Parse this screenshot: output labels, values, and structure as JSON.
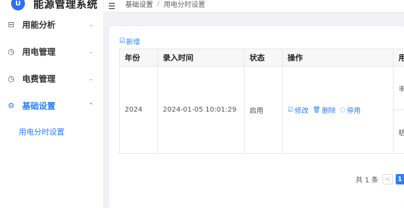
{
  "app": {
    "title": "能源管理系统",
    "logo_glyph": "U"
  },
  "sidebar": {
    "items": [
      {
        "label": "用能分析",
        "icon": "monitor-icon",
        "glyph": "⊟",
        "arrow": "⌄"
      },
      {
        "label": "用电管理",
        "icon": "gauge-icon",
        "glyph": "◷",
        "arrow": "⌄"
      },
      {
        "label": "电费管理",
        "icon": "gauge-icon",
        "glyph": "◷",
        "arrow": "⌄"
      },
      {
        "label": "基础设置",
        "icon": "gear-icon",
        "glyph": "⚙",
        "arrow": "⌃",
        "active": true
      }
    ],
    "sub_items": [
      {
        "label": "用电分时设置",
        "active": true
      }
    ]
  },
  "header": {
    "fold_glyph": "☰",
    "breadcrumb": [
      "基础设置",
      "用电分时设置"
    ],
    "separator": "/"
  },
  "toolbar": {
    "add_label": "新增",
    "add_glyph": "☑"
  },
  "table": {
    "columns": [
      "年份",
      "录入时间",
      "状态",
      "操作",
      "用电"
    ],
    "rows": [
      {
        "year": "2024",
        "created": "2024-01-05 10:01:29",
        "status": "启用",
        "actions": [
          {
            "label": "修改",
            "glyph": "☑"
          },
          {
            "label": "删除",
            "glyph": "🗑"
          },
          {
            "label": "停用",
            "glyph": "◌"
          }
        ],
        "periods": [
          "丰水",
          "枯水"
        ]
      }
    ]
  },
  "pagination": {
    "total_text": "共 1 条",
    "prev_glyph": "<",
    "current_page": "1"
  },
  "colors": {
    "accent": "#2d7ff9",
    "background": "#f0f2f5",
    "header_bg": "#f7f7f7"
  }
}
